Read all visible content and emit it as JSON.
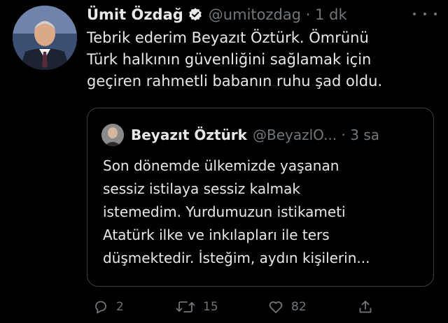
{
  "tweet": {
    "author": {
      "name": "Ümit Özdağ",
      "handle": "@umitozdag",
      "time": "1 dk",
      "verified": true
    },
    "text_lines": [
      "Tebrik ederim Beyazıt Öztürk. Ömrünü",
      "Türk halkının güvenliğini sağlamak için",
      "geçiren rahmetli babanın ruhu şad oldu."
    ],
    "quoted": {
      "name": "Beyazıt Öztürk",
      "handle": "@BeyazlO...",
      "time": "3 sa",
      "text_lines": [
        "Son dönemde ülkemizde yaşanan",
        "sessiz istilaya sessiz kalmak",
        "istemedim. Yurdumuzun istikameti",
        "Atatürk ilke ve inkılapları ile ters",
        "düşmektedir. İsteğim, aydın kişilerin..."
      ]
    },
    "actions": {
      "reply_count": "2",
      "retweet_count": "15",
      "like_count": "82"
    }
  },
  "colors": {
    "background": "#000000",
    "text_primary": "#e7e9ea",
    "text_secondary": "#71767b",
    "border": "#3a3f44"
  }
}
